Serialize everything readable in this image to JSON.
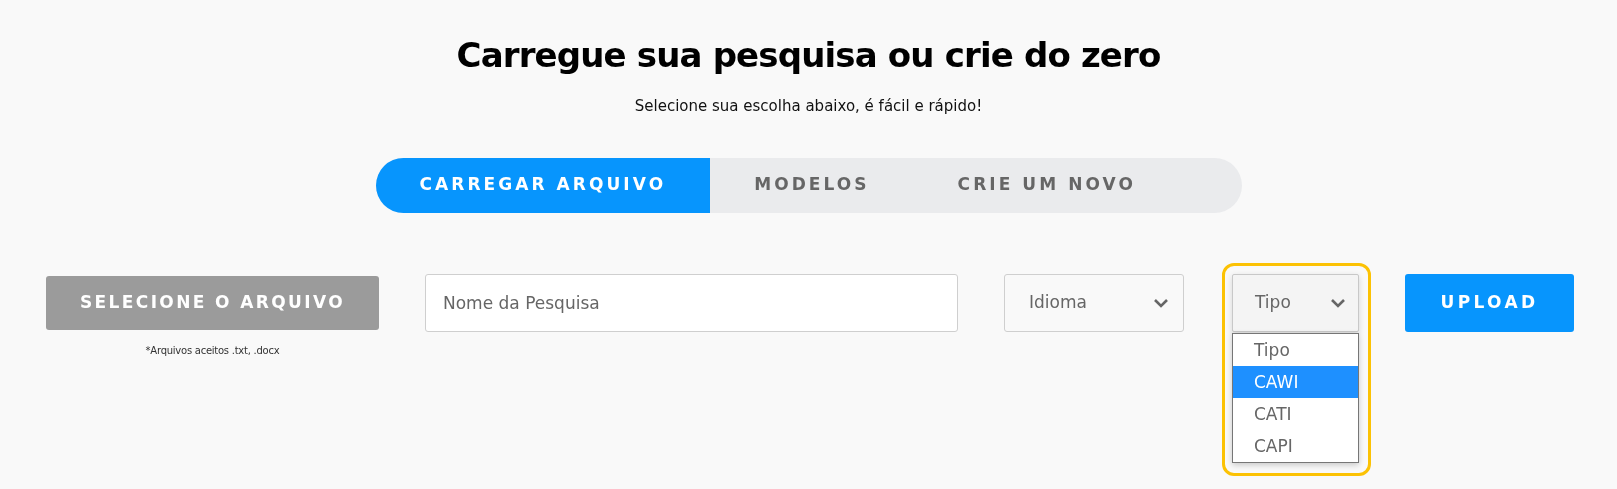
{
  "title": "Carregue sua pesquisa ou crie do zero",
  "subtitle": "Selecione sua escolha abaixo, é fácil e rápido!",
  "tabs": [
    {
      "label": "CARREGAR ARQUIVO",
      "selected": true
    },
    {
      "label": "MODELOS",
      "selected": false
    },
    {
      "label": "CRIE UM NOVO",
      "selected": false
    }
  ],
  "file_button": "SELECIONE O ARQUIVO",
  "file_note": "*Arquivos aceitos .txt, .docx",
  "name_field": {
    "placeholder": "Nome da Pesquisa"
  },
  "language_select": {
    "value": "Idioma"
  },
  "type_select": {
    "value": "Tipo",
    "expanded": true,
    "highlighted": true
  },
  "type_options": [
    {
      "label": "Tipo",
      "selected": false
    },
    {
      "label": "CAWI",
      "selected": true
    },
    {
      "label": "CATI",
      "selected": false
    },
    {
      "label": "CAPI",
      "selected": false
    }
  ],
  "upload_button": "UPLOAD"
}
